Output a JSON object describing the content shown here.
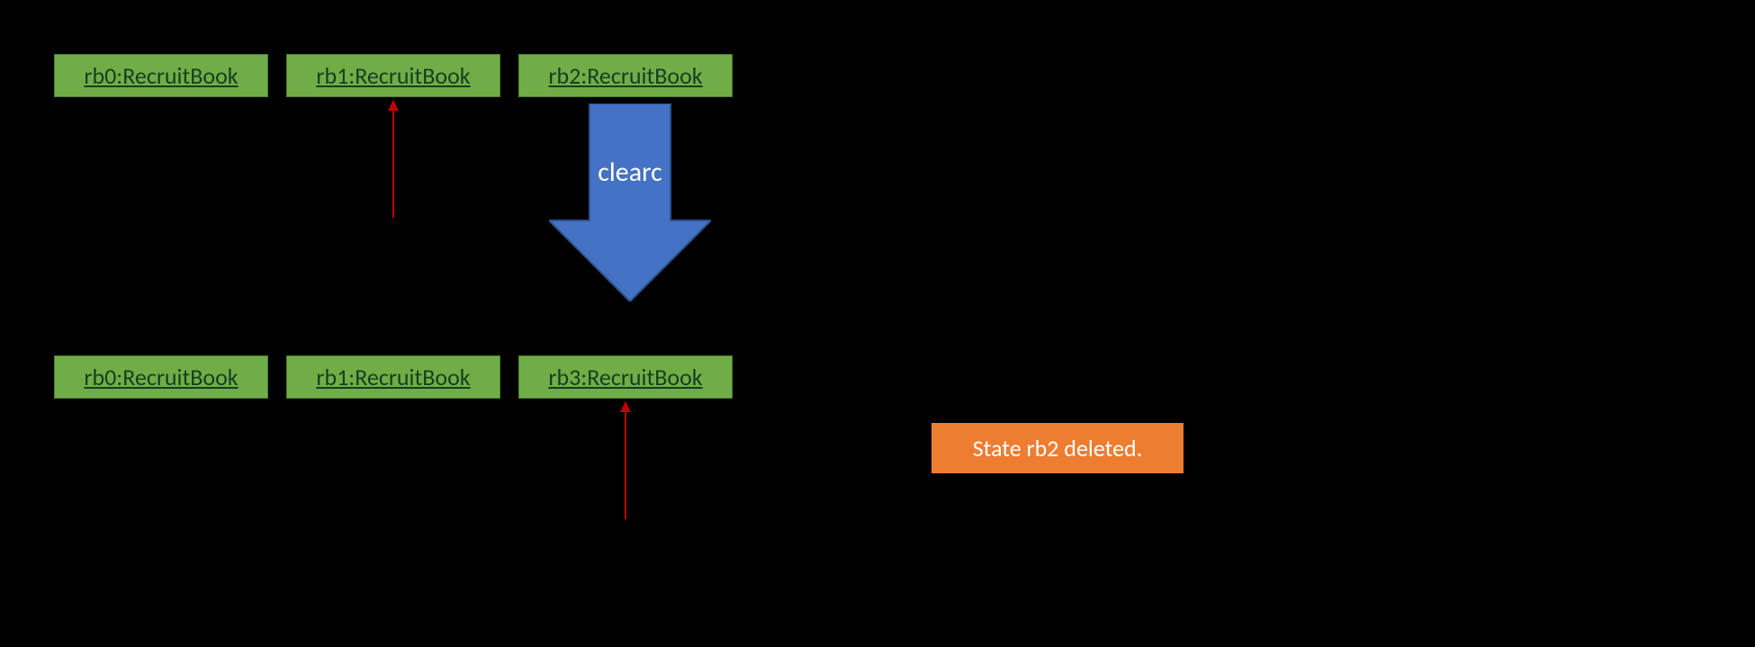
{
  "colors": {
    "object_fill": "#70AD47",
    "object_border": "#507E32",
    "object_text": "#153E20",
    "arrow_fill": "#4472C4",
    "arrow_outline": "#2F528F",
    "pointer_red": "#C00000",
    "note_fill": "#ED7D31",
    "background": "#000000"
  },
  "top_row": [
    {
      "label": "rb0:RecruitBook"
    },
    {
      "label": "rb1:RecruitBook"
    },
    {
      "label": "rb2:RecruitBook"
    }
  ],
  "bottom_row": [
    {
      "label": "rb0:RecruitBook"
    },
    {
      "label": "rb1:RecruitBook"
    },
    {
      "label": "rb3:RecruitBook"
    }
  ],
  "arrow_label": "clearc",
  "note_label": "State rb2 deleted.",
  "top_pointer_index": 1,
  "bottom_pointer_index": 2
}
